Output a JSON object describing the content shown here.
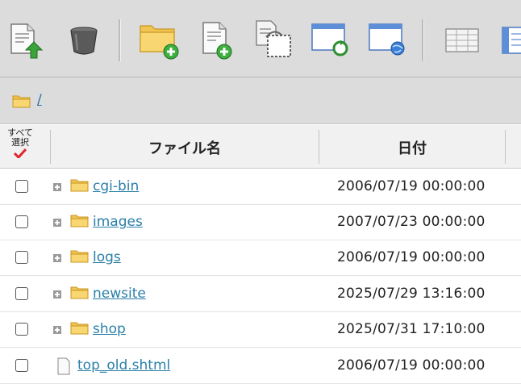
{
  "toolbar": {
    "buttons": [
      {
        "icon": "upload-icon"
      },
      {
        "icon": "trash-icon"
      },
      {
        "icon": "new-folder-icon"
      },
      {
        "icon": "new-file-icon"
      },
      {
        "icon": "copy-paste-icon"
      },
      {
        "icon": "refresh-window-icon"
      },
      {
        "icon": "browser-window-icon"
      },
      {
        "icon": "list-view-icon"
      },
      {
        "icon": "detail-view-icon"
      }
    ]
  },
  "path": {
    "current": "/"
  },
  "table": {
    "select_all_label_line1": "すべて",
    "select_all_label_line2": "選択",
    "col_name": "ファイル名",
    "col_date": "日付"
  },
  "rows": [
    {
      "name": "cgi-bin",
      "date": "2006/07/19 00:00:00",
      "type": "folder"
    },
    {
      "name": "images",
      "date": "2007/07/23 00:00:00",
      "type": "folder"
    },
    {
      "name": "logs",
      "date": "2006/07/19 00:00:00",
      "type": "folder"
    },
    {
      "name": "newsite",
      "date": "2025/07/29 13:16:00",
      "type": "folder"
    },
    {
      "name": "shop",
      "date": "2025/07/31 17:10:00",
      "type": "folder"
    },
    {
      "name": "top_old.shtml",
      "date": "2006/07/19 00:00:00",
      "type": "file"
    }
  ],
  "colors": {
    "link": "#2a7fa8",
    "folder": "#f3c85a",
    "toolbar_bg": "#dcdcdc"
  }
}
